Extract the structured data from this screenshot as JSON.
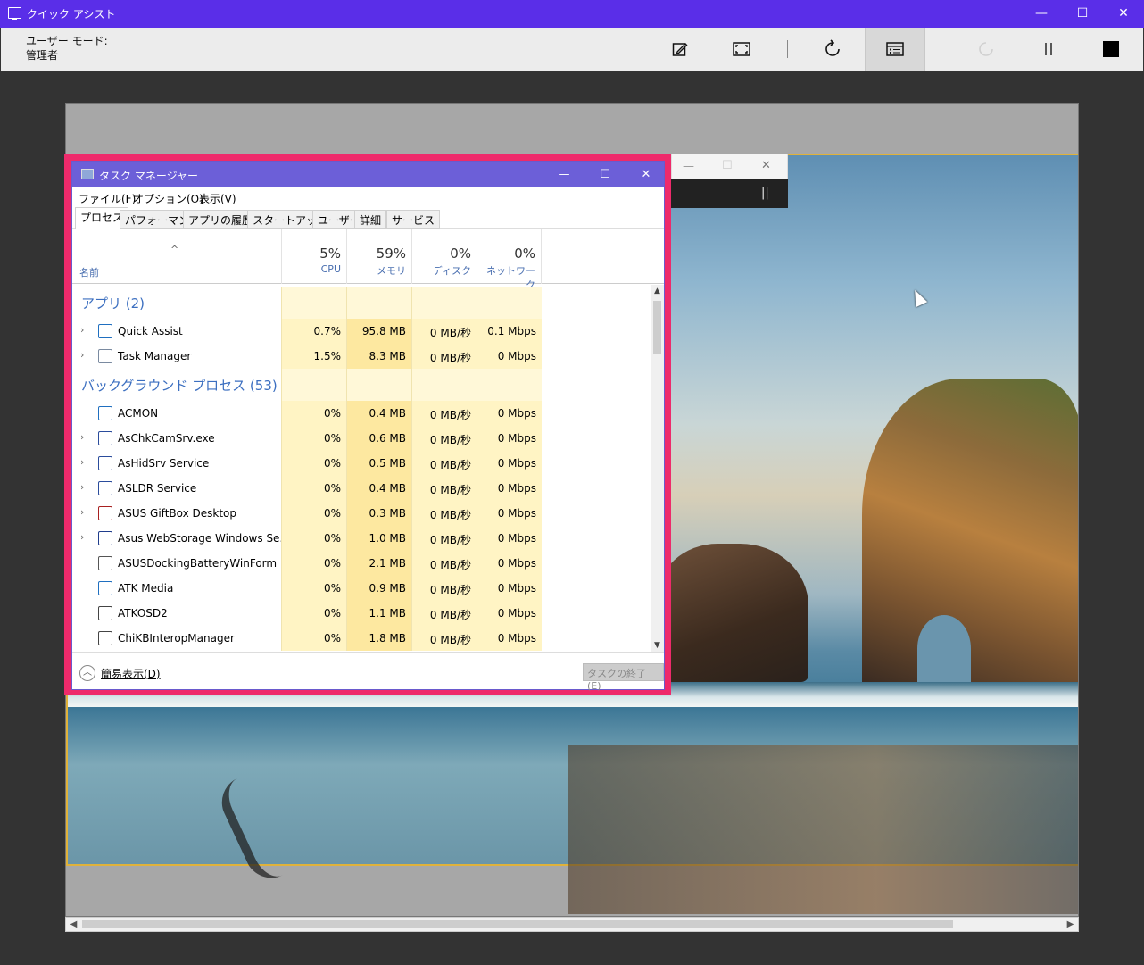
{
  "qa": {
    "title": "クイック アシスト",
    "mode_label": "ユーザー モード:",
    "mode_value": "管理者",
    "buttons": {
      "minimize": "—",
      "maximize": "☐",
      "close": "✕"
    }
  },
  "tm": {
    "title": "タスク マネージャー",
    "menu": [
      "ファイル(F)",
      "オプション(O)",
      "表示(V)"
    ],
    "tabs": [
      "プロセス",
      "パフォーマンス",
      "アプリの履歴",
      "スタートアップ",
      "ユーザー",
      "詳細",
      "サービス"
    ],
    "columns": {
      "name": "名前",
      "cpu": {
        "pct": "5%",
        "label": "CPU"
      },
      "mem": {
        "pct": "59%",
        "label": "メモリ"
      },
      "disk": {
        "pct": "0%",
        "label": "ディスク"
      },
      "net": {
        "pct": "0%",
        "label": "ネットワーク"
      }
    },
    "groups": {
      "apps": "アプリ (2)",
      "background": "バックグラウンド プロセス (53)"
    },
    "apps": [
      {
        "name": "Quick Assist",
        "cpu": "0.7%",
        "mem": "95.8 MB",
        "disk": "0 MB/秒",
        "net": "0.1 Mbps"
      },
      {
        "name": "Task Manager",
        "cpu": "1.5%",
        "mem": "8.3 MB",
        "disk": "0 MB/秒",
        "net": "0 Mbps"
      }
    ],
    "background": [
      {
        "name": "ACMON",
        "cpu": "0%",
        "mem": "0.4 MB",
        "disk": "0 MB/秒",
        "net": "0 Mbps"
      },
      {
        "name": "AsChkCamSrv.exe",
        "cpu": "0%",
        "mem": "0.6 MB",
        "disk": "0 MB/秒",
        "net": "0 Mbps"
      },
      {
        "name": "AsHidSrv Service",
        "cpu": "0%",
        "mem": "0.5 MB",
        "disk": "0 MB/秒",
        "net": "0 Mbps"
      },
      {
        "name": "ASLDR Service",
        "cpu": "0%",
        "mem": "0.4 MB",
        "disk": "0 MB/秒",
        "net": "0 Mbps"
      },
      {
        "name": "ASUS GiftBox Desktop",
        "cpu": "0%",
        "mem": "0.3 MB",
        "disk": "0 MB/秒",
        "net": "0 Mbps"
      },
      {
        "name": "Asus WebStorage Windows Se...",
        "cpu": "0%",
        "mem": "1.0 MB",
        "disk": "0 MB/秒",
        "net": "0 Mbps"
      },
      {
        "name": "ASUSDockingBatteryWinForm",
        "cpu": "0%",
        "mem": "2.1 MB",
        "disk": "0 MB/秒",
        "net": "0 Mbps"
      },
      {
        "name": "ATK Media",
        "cpu": "0%",
        "mem": "0.9 MB",
        "disk": "0 MB/秒",
        "net": "0 Mbps"
      },
      {
        "name": "ATKOSD2",
        "cpu": "0%",
        "mem": "1.1 MB",
        "disk": "0 MB/秒",
        "net": "0 Mbps"
      },
      {
        "name": "ChiKBInteropManager",
        "cpu": "0%",
        "mem": "1.8 MB",
        "disk": "0 MB/秒",
        "net": "0 Mbps"
      }
    ],
    "footer": {
      "less_details": "簡易表示(D)",
      "end_task": "タスクの終了(E)"
    }
  },
  "colors": {
    "qa_titlebar": "#5a2ee8",
    "tm_highlight_border": "#ee2a6b",
    "tm_titlebar": "#6c5fd8",
    "cell_light": "#fff4c4",
    "cell_mid": "#fde8a0"
  }
}
